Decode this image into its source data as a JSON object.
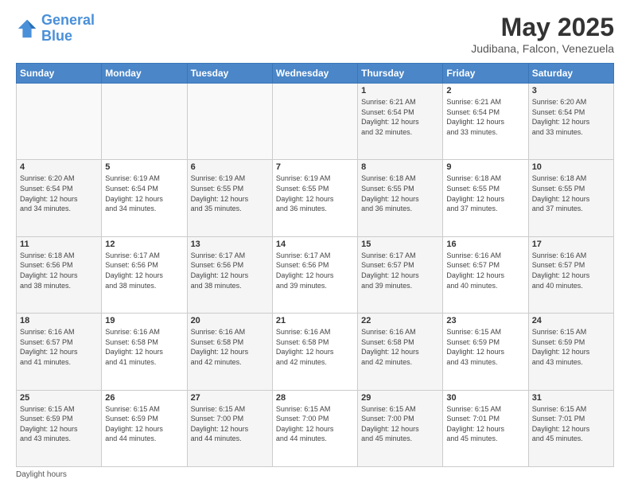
{
  "header": {
    "logo_line1": "General",
    "logo_line2": "Blue",
    "month_title": "May 2025",
    "location": "Judibana, Falcon, Venezuela"
  },
  "weekdays": [
    "Sunday",
    "Monday",
    "Tuesday",
    "Wednesday",
    "Thursday",
    "Friday",
    "Saturday"
  ],
  "footer": {
    "note": "Daylight hours"
  },
  "weeks": [
    [
      {
        "day": "",
        "info": ""
      },
      {
        "day": "",
        "info": ""
      },
      {
        "day": "",
        "info": ""
      },
      {
        "day": "",
        "info": ""
      },
      {
        "day": "1",
        "info": "Sunrise: 6:21 AM\nSunset: 6:54 PM\nDaylight: 12 hours\nand 32 minutes."
      },
      {
        "day": "2",
        "info": "Sunrise: 6:21 AM\nSunset: 6:54 PM\nDaylight: 12 hours\nand 33 minutes."
      },
      {
        "day": "3",
        "info": "Sunrise: 6:20 AM\nSunset: 6:54 PM\nDaylight: 12 hours\nand 33 minutes."
      }
    ],
    [
      {
        "day": "4",
        "info": "Sunrise: 6:20 AM\nSunset: 6:54 PM\nDaylight: 12 hours\nand 34 minutes."
      },
      {
        "day": "5",
        "info": "Sunrise: 6:19 AM\nSunset: 6:54 PM\nDaylight: 12 hours\nand 34 minutes."
      },
      {
        "day": "6",
        "info": "Sunrise: 6:19 AM\nSunset: 6:55 PM\nDaylight: 12 hours\nand 35 minutes."
      },
      {
        "day": "7",
        "info": "Sunrise: 6:19 AM\nSunset: 6:55 PM\nDaylight: 12 hours\nand 36 minutes."
      },
      {
        "day": "8",
        "info": "Sunrise: 6:18 AM\nSunset: 6:55 PM\nDaylight: 12 hours\nand 36 minutes."
      },
      {
        "day": "9",
        "info": "Sunrise: 6:18 AM\nSunset: 6:55 PM\nDaylight: 12 hours\nand 37 minutes."
      },
      {
        "day": "10",
        "info": "Sunrise: 6:18 AM\nSunset: 6:55 PM\nDaylight: 12 hours\nand 37 minutes."
      }
    ],
    [
      {
        "day": "11",
        "info": "Sunrise: 6:18 AM\nSunset: 6:56 PM\nDaylight: 12 hours\nand 38 minutes."
      },
      {
        "day": "12",
        "info": "Sunrise: 6:17 AM\nSunset: 6:56 PM\nDaylight: 12 hours\nand 38 minutes."
      },
      {
        "day": "13",
        "info": "Sunrise: 6:17 AM\nSunset: 6:56 PM\nDaylight: 12 hours\nand 38 minutes."
      },
      {
        "day": "14",
        "info": "Sunrise: 6:17 AM\nSunset: 6:56 PM\nDaylight: 12 hours\nand 39 minutes."
      },
      {
        "day": "15",
        "info": "Sunrise: 6:17 AM\nSunset: 6:57 PM\nDaylight: 12 hours\nand 39 minutes."
      },
      {
        "day": "16",
        "info": "Sunrise: 6:16 AM\nSunset: 6:57 PM\nDaylight: 12 hours\nand 40 minutes."
      },
      {
        "day": "17",
        "info": "Sunrise: 6:16 AM\nSunset: 6:57 PM\nDaylight: 12 hours\nand 40 minutes."
      }
    ],
    [
      {
        "day": "18",
        "info": "Sunrise: 6:16 AM\nSunset: 6:57 PM\nDaylight: 12 hours\nand 41 minutes."
      },
      {
        "day": "19",
        "info": "Sunrise: 6:16 AM\nSunset: 6:58 PM\nDaylight: 12 hours\nand 41 minutes."
      },
      {
        "day": "20",
        "info": "Sunrise: 6:16 AM\nSunset: 6:58 PM\nDaylight: 12 hours\nand 42 minutes."
      },
      {
        "day": "21",
        "info": "Sunrise: 6:16 AM\nSunset: 6:58 PM\nDaylight: 12 hours\nand 42 minutes."
      },
      {
        "day": "22",
        "info": "Sunrise: 6:16 AM\nSunset: 6:58 PM\nDaylight: 12 hours\nand 42 minutes."
      },
      {
        "day": "23",
        "info": "Sunrise: 6:15 AM\nSunset: 6:59 PM\nDaylight: 12 hours\nand 43 minutes."
      },
      {
        "day": "24",
        "info": "Sunrise: 6:15 AM\nSunset: 6:59 PM\nDaylight: 12 hours\nand 43 minutes."
      }
    ],
    [
      {
        "day": "25",
        "info": "Sunrise: 6:15 AM\nSunset: 6:59 PM\nDaylight: 12 hours\nand 43 minutes."
      },
      {
        "day": "26",
        "info": "Sunrise: 6:15 AM\nSunset: 6:59 PM\nDaylight: 12 hours\nand 44 minutes."
      },
      {
        "day": "27",
        "info": "Sunrise: 6:15 AM\nSunset: 7:00 PM\nDaylight: 12 hours\nand 44 minutes."
      },
      {
        "day": "28",
        "info": "Sunrise: 6:15 AM\nSunset: 7:00 PM\nDaylight: 12 hours\nand 44 minutes."
      },
      {
        "day": "29",
        "info": "Sunrise: 6:15 AM\nSunset: 7:00 PM\nDaylight: 12 hours\nand 45 minutes."
      },
      {
        "day": "30",
        "info": "Sunrise: 6:15 AM\nSunset: 7:01 PM\nDaylight: 12 hours\nand 45 minutes."
      },
      {
        "day": "31",
        "info": "Sunrise: 6:15 AM\nSunset: 7:01 PM\nDaylight: 12 hours\nand 45 minutes."
      }
    ]
  ]
}
